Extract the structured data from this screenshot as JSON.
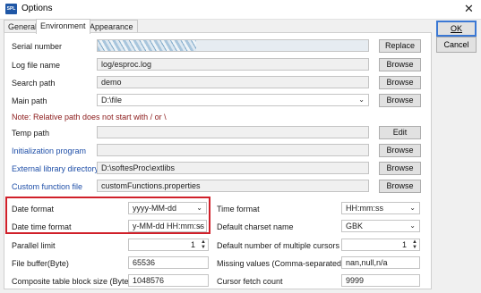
{
  "window": {
    "title": "Options",
    "app_icon_text": "SPL"
  },
  "tabs": [
    "General",
    "Environment",
    "Appearance"
  ],
  "buttons": {
    "ok": "OK",
    "cancel": "Cancel"
  },
  "rows": {
    "serial": {
      "label": "Serial number",
      "button": "Replace"
    },
    "log": {
      "label": "Log file name",
      "value": "log/esproc.log",
      "button": "Browse"
    },
    "search": {
      "label": "Search path",
      "value": "demo",
      "button": "Browse"
    },
    "main": {
      "label": "Main path",
      "value": "D:\\file",
      "button": "Browse"
    },
    "note": "Note: Relative path does not start with / or \\",
    "temp": {
      "label": "Temp path",
      "value": "",
      "button": "Edit"
    },
    "init": {
      "label": "Initialization program",
      "value": "",
      "button": "Browse"
    },
    "extlib": {
      "label": "External library directory",
      "value": "D:\\softesProc\\extlibs",
      "button": "Browse"
    },
    "customfn": {
      "label": "Custom function file",
      "value": "customFunctions.properties",
      "button": "Browse"
    }
  },
  "settings": {
    "date_format": {
      "label": "Date format",
      "value": "yyyy-MM-dd"
    },
    "datetime_format": {
      "label": "Date time format",
      "value": "y-MM-dd HH:mm:ss"
    },
    "parallel": {
      "label": "Parallel limit",
      "value": "1"
    },
    "file_buffer": {
      "label": "File buffer(Byte)",
      "value": "65536"
    },
    "block_size": {
      "label": "Composite table block size (Byte)",
      "value": "1048576"
    },
    "time_format": {
      "label": "Time format",
      "value": "HH:mm:ss"
    },
    "charset": {
      "label": "Default charset name",
      "value": "GBK"
    },
    "cursors": {
      "label": "Default number of multiple cursors",
      "value": "1"
    },
    "missing": {
      "label": "Missing values (Comma-separated)",
      "value": "nan,null,n/a"
    },
    "fetch": {
      "label": "Cursor fetch count",
      "value": "9999"
    }
  },
  "colors": {
    "highlight_border": "#d0202a",
    "blue_label": "#1f4fa8",
    "note": "#8b1a1a"
  }
}
